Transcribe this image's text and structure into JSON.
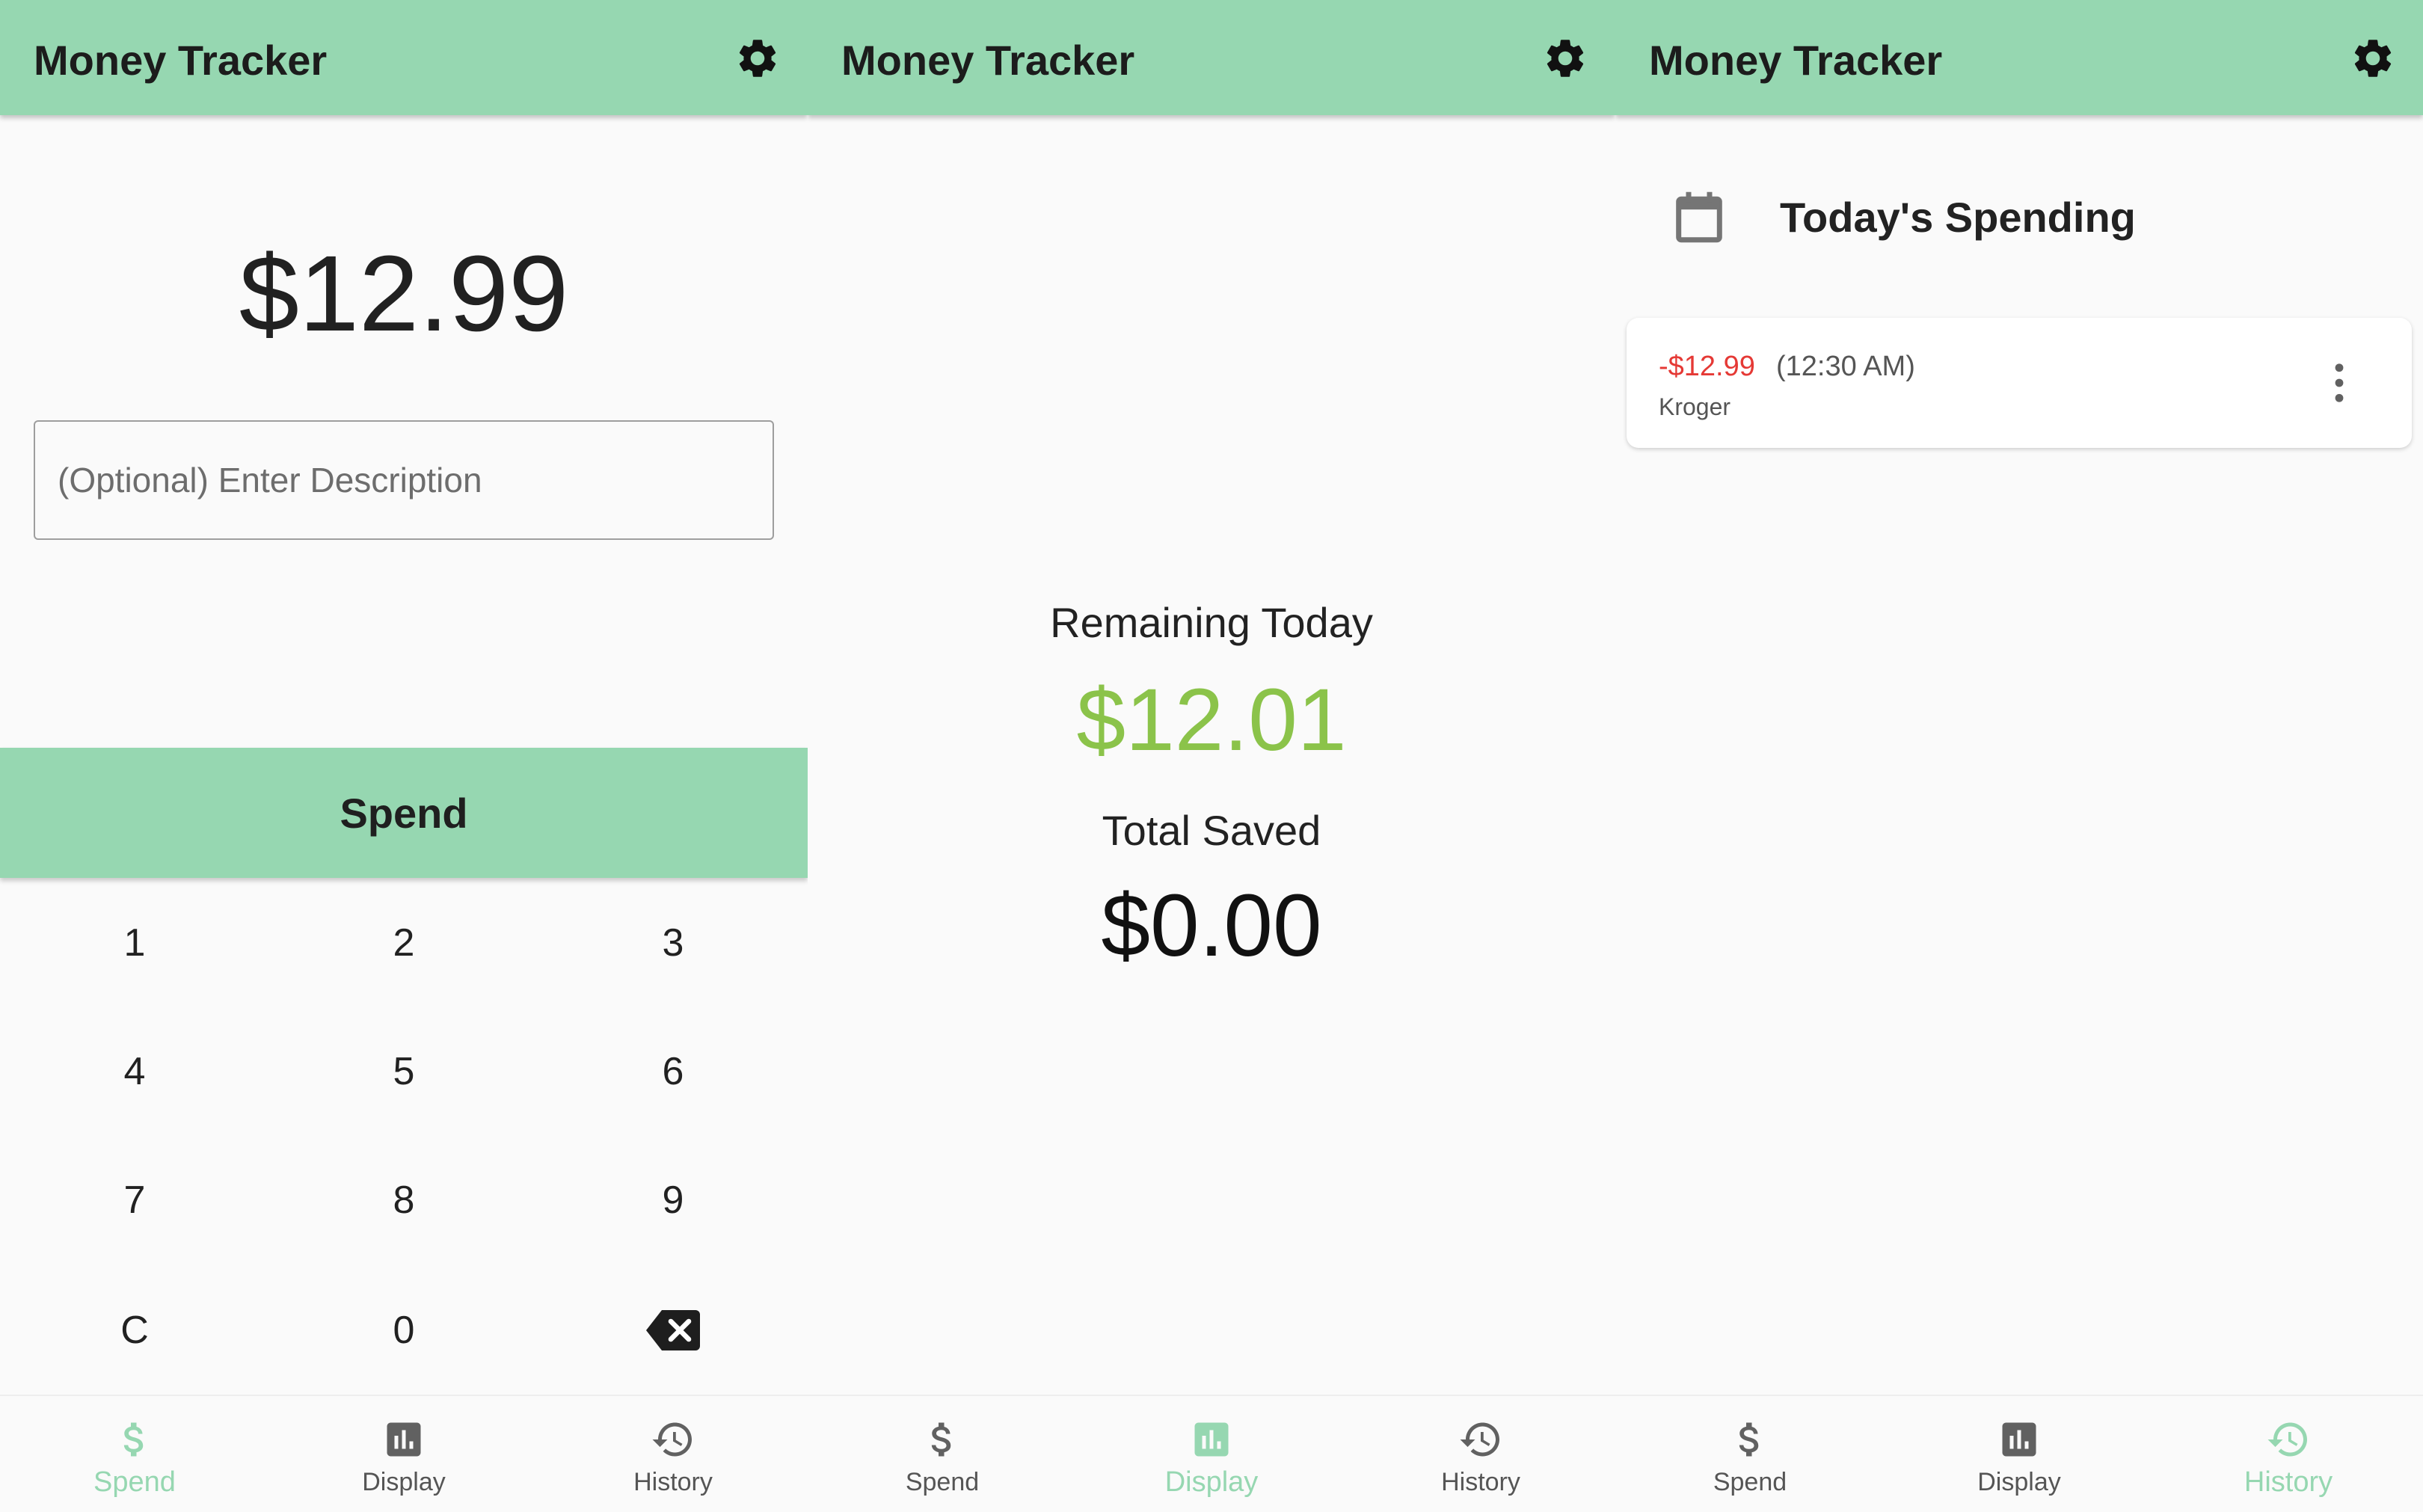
{
  "colors": {
    "accent": "#96d7b1",
    "positive": "#8bc34a",
    "negative": "#e53935"
  },
  "app_title": "Money Tracker",
  "nav": {
    "spend": "Spend",
    "display": "Display",
    "history": "History"
  },
  "spend_screen": {
    "amount": "$12.99",
    "description_placeholder": "(Optional) Enter Description",
    "spend_button": "Spend",
    "keys": [
      "1",
      "2",
      "3",
      "4",
      "5",
      "6",
      "7",
      "8",
      "9",
      "C",
      "0"
    ],
    "backspace_icon": "backspace-icon"
  },
  "display_screen": {
    "remaining_label": "Remaining Today",
    "remaining_value": "$12.01",
    "saved_label": "Total Saved",
    "saved_value": "$0.00"
  },
  "history_screen": {
    "heading": "Today's Spending",
    "entries": [
      {
        "amount": "-$12.99",
        "time": "(12:30 AM)",
        "description": "Kroger"
      }
    ]
  }
}
